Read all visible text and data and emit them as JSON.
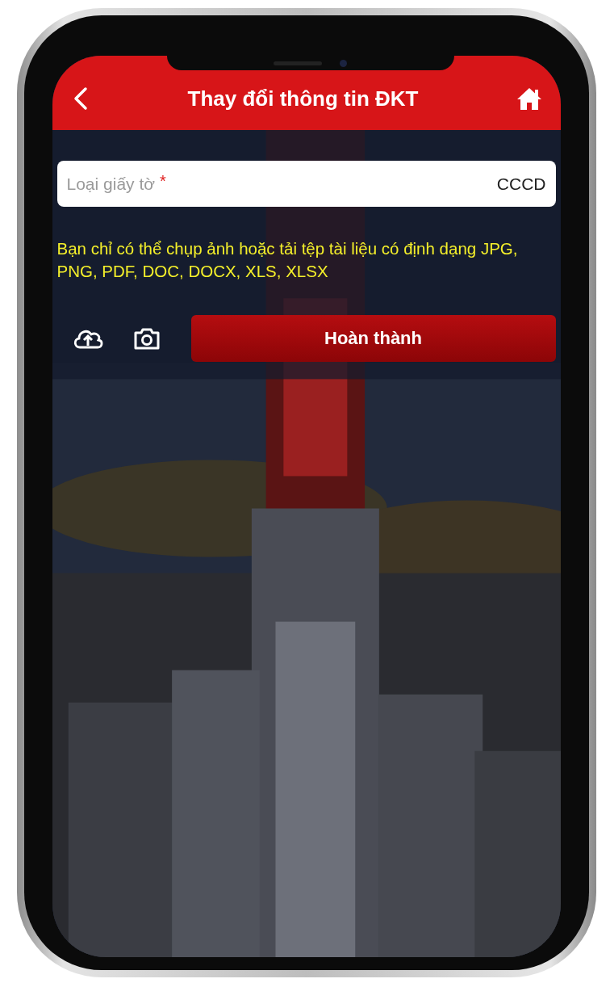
{
  "header": {
    "title": "Thay đổi thông tin ĐKT"
  },
  "document_type": {
    "label": "Loại giấy tờ",
    "required_mark": "*",
    "value": "CCCD"
  },
  "hint": "Bạn chỉ có thể chụp ảnh hoặc tải tệp tài liệu có định dạng JPG, PNG, PDF, DOC, DOCX, XLS, XLSX",
  "actions": {
    "submit": "Hoàn thành"
  }
}
